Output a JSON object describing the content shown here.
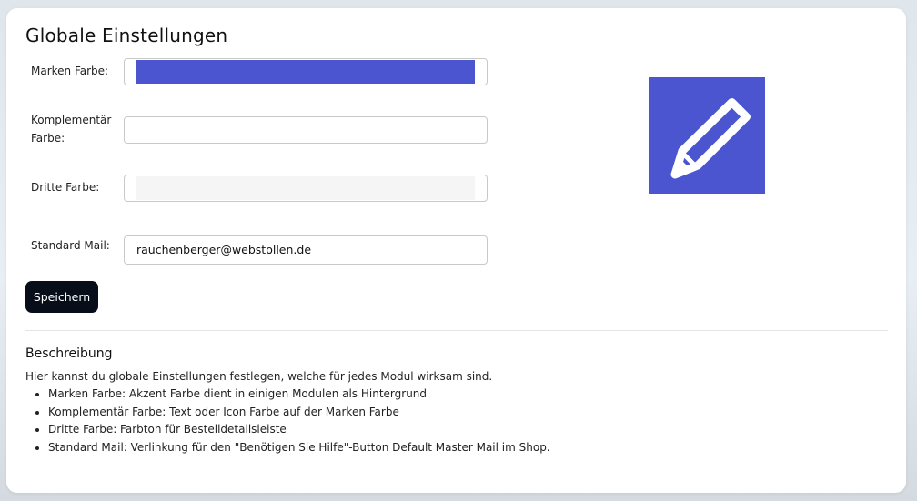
{
  "page": {
    "title": "Globale Einstellungen"
  },
  "form": {
    "brand_color": {
      "label": "Marken Farbe:",
      "value": "#4a55cf"
    },
    "complementary_color": {
      "label": "Komplementär Farbe:",
      "value": "#ffffff"
    },
    "third_color": {
      "label": "Dritte Farbe:",
      "value": "#f5f5f5"
    },
    "standard_mail": {
      "label": "Standard Mail:",
      "value": "rauchenberger@webstollen.de"
    },
    "save_label": "Speichern"
  },
  "preview": {
    "icon": "pencil-icon",
    "background": "#4a55cf",
    "icon_color": "#ffffff"
  },
  "description": {
    "title": "Beschreibung",
    "intro": "Hier kannst du globale Einstellungen festlegen, welche für jedes Modul wirksam sind.",
    "items": [
      "Marken Farbe: Akzent Farbe dient in einigen Modulen als Hintergrund",
      "Komplementär Farbe: Text oder Icon Farbe auf der Marken Farbe",
      "Dritte Farbe: Farbton für Bestelldetailsleiste",
      "Standard Mail: Verlinkung für den \"Benötigen Sie Hilfe\"-Button Default Master Mail im Shop."
    ]
  }
}
